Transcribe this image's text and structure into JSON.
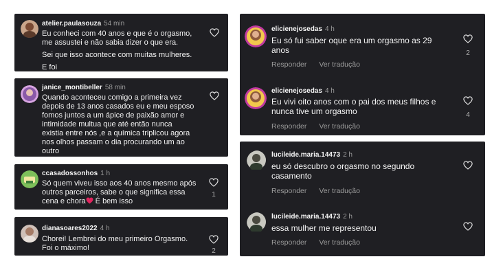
{
  "left": [
    {
      "user": "atelier.paulasouza",
      "time": "54 min",
      "lines": [
        "Eu conheci com 40 anos e que é o orgasmo,",
        "me assustei e não sabia dizer o que era.",
        "",
        "Sei que isso acontece com muitas mulheres.",
        "",
        "E foi"
      ]
    },
    {
      "user": "janice_montibeller",
      "time": "58 min",
      "lines": [
        "Quando aconteceu comigo a primeira vez",
        "depois de 13 anos casados eu e meu esposo",
        "fomos juntos a um ápice de paixão amor e",
        "intimidade multua que até então nunca",
        "existia entre nós ,e a química triplicou agora",
        "nos olhos passam o dia procurando um ao",
        "outro"
      ]
    },
    {
      "user": "ccasadossonhos",
      "time": "1 h",
      "lines": [
        "Só quem viveu isso aos 40 anos mesmo após",
        "outros parceiros, sabe o que significa essa",
        "cena e chora",
        "É bem isso"
      ],
      "likes": "1"
    },
    {
      "user": "dianasoares2022",
      "time": "4 h",
      "lines": [
        "Chorei! Lembrei do meu primeiro Orgasmo.",
        "Foi o máximo!"
      ],
      "likes": "2"
    }
  ],
  "right": [
    {
      "user": "elicienejosedas",
      "time": "4 h",
      "lines": [
        "Eu só fui saber oque era um orgasmo as 29",
        "anos"
      ],
      "likes": "2",
      "reply": "Responder",
      "translate": "Ver tradução"
    },
    {
      "user": "elicienejosedas",
      "time": "4 h",
      "lines": [
        "Eu vivi oito anos com o pai dos meus filhos e",
        "nunca tive um orgasmo"
      ],
      "likes": "4",
      "reply": "Responder",
      "translate": "Ver tradução"
    },
    {
      "user": "lucileide.maria.14473",
      "time": "2 h",
      "lines": [
        "eu só descubro o orgasmo no segundo",
        "casamento"
      ],
      "reply": "Responder",
      "translate": "Ver tradução"
    },
    {
      "user": "lucileide.maria.14473",
      "time": "2 h",
      "lines": [
        "essa mulher me representou"
      ],
      "reply": "Responder",
      "translate": "Ver tradução"
    }
  ],
  "colors": {
    "background": "#1f1f23",
    "heart_emoji": "#e0245e"
  },
  "icons": [
    "heart-outline-icon",
    "red-heart-emoji"
  ]
}
